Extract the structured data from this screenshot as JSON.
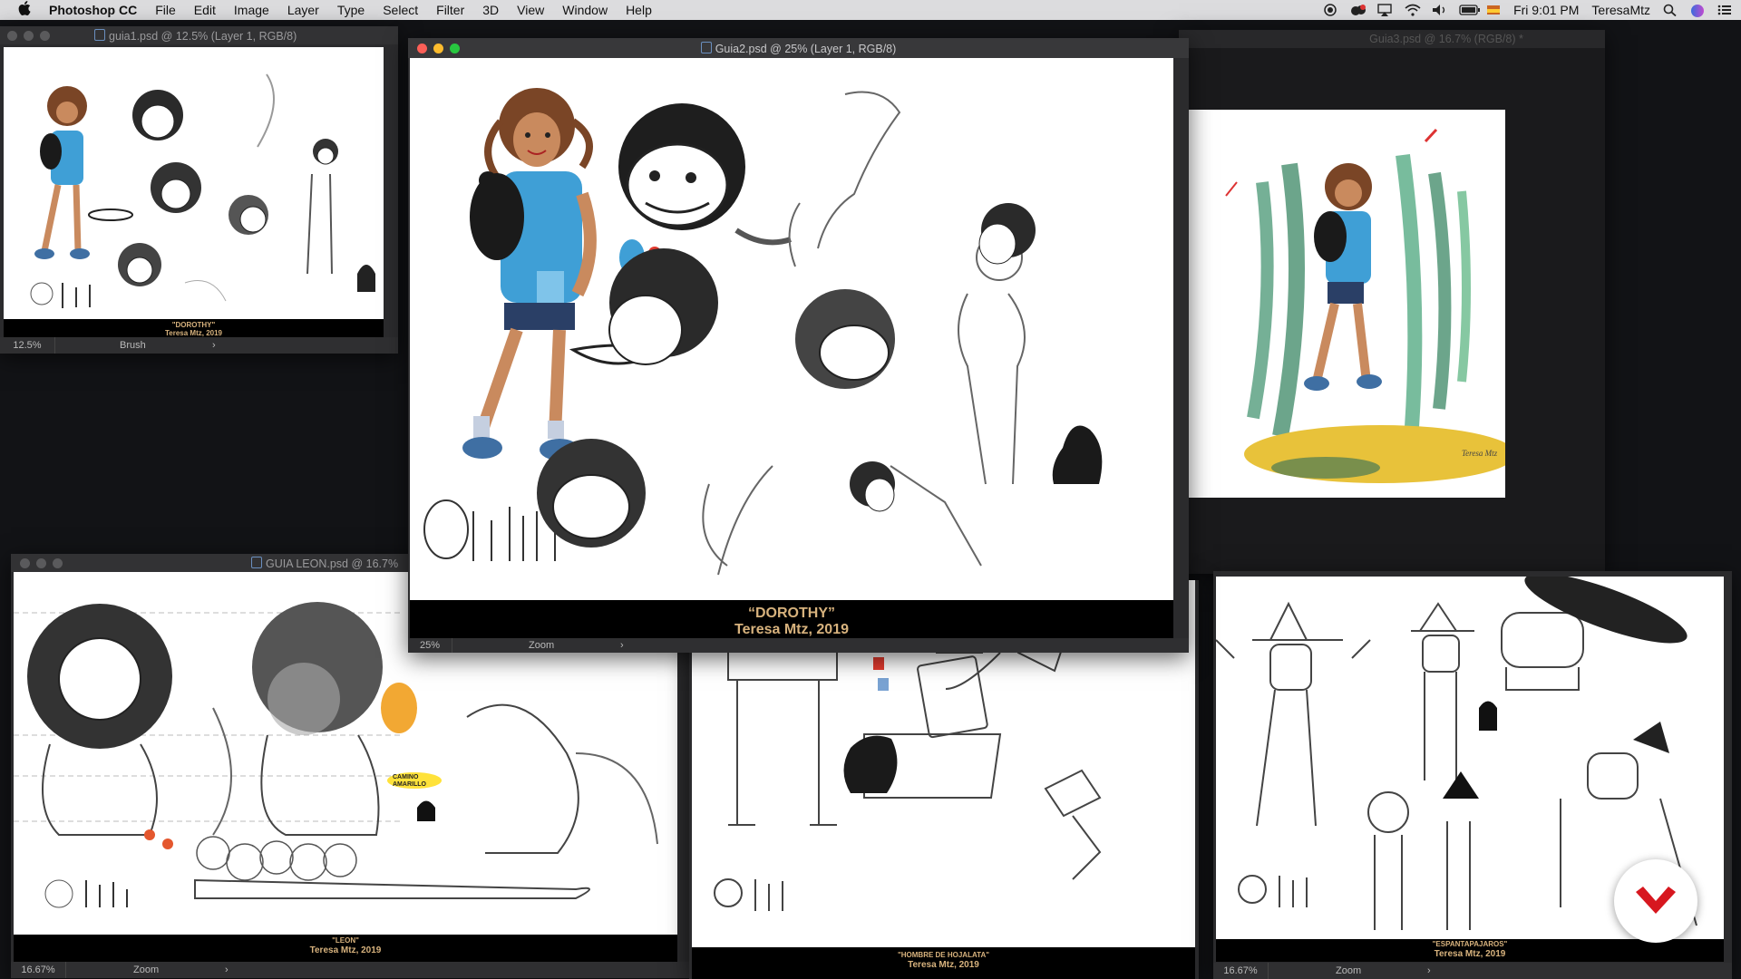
{
  "menubar": {
    "app_name": "Photoshop CC",
    "items": [
      "File",
      "Edit",
      "Image",
      "Layer",
      "Type",
      "Select",
      "Filter",
      "3D",
      "View",
      "Window",
      "Help"
    ],
    "clock": "Fri 9:01 PM",
    "user": "TeresaMtz"
  },
  "windows": {
    "guia1": {
      "title": "guia1.psd @ 12.5% (Layer 1, RGB/8)",
      "caption_title": "\"DOROTHY\"",
      "caption_sub": "Teresa Mtz, 2019",
      "zoom": "12.5%",
      "tool": "Brush"
    },
    "guia2": {
      "title": "Guia2.psd @ 25% (Layer 1, RGB/8)",
      "caption_title": "“DOROTHY”",
      "caption_sub": "Teresa Mtz, 2019",
      "zoom": "25%",
      "tool": "Zoom"
    },
    "guia3": {
      "title": "Guia3.psd @ 16.7% (RGB/8) *"
    },
    "leon": {
      "title": "GUIA LEON.psd @ 16.7%",
      "caption_title": "\"LEON\"",
      "caption_sub": "Teresa Mtz, 2019",
      "zoom": "16.67%",
      "tool": "Zoom",
      "sign": "CAMINO AMARILLO"
    },
    "hojalata": {
      "caption_title": "\"HOMBRE DE HOJALATA\"",
      "caption_sub": "Teresa Mtz, 2019"
    },
    "espantapajaros": {
      "caption_title": "\"ESPANTAPAJAROS\"",
      "caption_sub": "Teresa Mtz, 2019",
      "zoom": "16.67%",
      "tool": "Zoom"
    }
  },
  "colors": {
    "accent_red": "#d7171f",
    "caption_gold": "#d7b27d",
    "dorothy_blue": "#3f9fd6"
  },
  "icons": [
    "apple-icon",
    "wifi-icon",
    "volume-icon",
    "battery-icon",
    "search-icon",
    "siri-icon",
    "list-icon",
    "file-icon",
    "brand-logo-icon"
  ]
}
